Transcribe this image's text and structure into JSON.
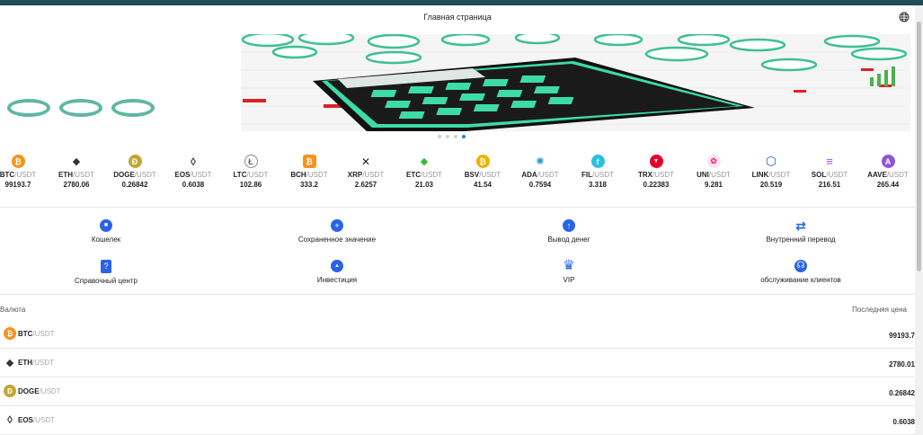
{
  "header": {
    "title": "Главная страница",
    "language_icon": "globe-icon"
  },
  "banner": {
    "slides_count": 4,
    "active_slide": 4
  },
  "ticker": [
    {
      "base": "BTC",
      "quote": "/USDT",
      "price": "99193.7",
      "icon": "bitcoin-icon",
      "color": "#f7931a",
      "glyph": "₿"
    },
    {
      "base": "ETH",
      "quote": "/USDT",
      "price": "2780.06",
      "icon": "ethereum-icon",
      "color": "#3c3c3d",
      "glyph": "◆"
    },
    {
      "base": "DOGE",
      "quote": "/USDT",
      "price": "0.26842",
      "icon": "dogecoin-icon",
      "color": "#c2a633",
      "glyph": "Ð"
    },
    {
      "base": "EOS",
      "quote": "/USDT",
      "price": "0.6038",
      "icon": "eos-icon",
      "color": "#ffffff",
      "glyph": "◊"
    },
    {
      "base": "LTC",
      "quote": "/USDT",
      "price": "102.86",
      "icon": "litecoin-icon",
      "color": "#ffffff",
      "glyph": "Ł"
    },
    {
      "base": "BCH",
      "quote": "/USDT",
      "price": "333.2",
      "icon": "bitcoin-cash-icon",
      "color": "#f7931a",
      "glyph": "₿"
    },
    {
      "base": "XRP",
      "quote": "/USDT",
      "price": "2.6257",
      "icon": "xrp-icon",
      "color": "#ffffff",
      "glyph": "✕"
    },
    {
      "base": "ETC",
      "quote": "/USDT",
      "price": "21.03",
      "icon": "ethereum-classic-icon",
      "color": "#ffffff",
      "glyph": "◆"
    },
    {
      "base": "BSV",
      "quote": "/USDT",
      "price": "41.54",
      "icon": "bitcoin-sv-icon",
      "color": "#eab300",
      "glyph": "₿"
    },
    {
      "base": "ADA",
      "quote": "/USDT",
      "price": "0.7594",
      "icon": "cardano-icon",
      "color": "#ffffff",
      "glyph": "✺"
    },
    {
      "base": "FIL",
      "quote": "/USDT",
      "price": "3.318",
      "icon": "filecoin-icon",
      "color": "#0090ff",
      "glyph": "f"
    },
    {
      "base": "TRX",
      "quote": "/USDT",
      "price": "0.22383",
      "icon": "tron-icon",
      "color": "#eb0029",
      "glyph": "▼"
    },
    {
      "base": "UNI",
      "quote": "/USDT",
      "price": "9.281",
      "icon": "uniswap-icon",
      "color": "#ff007a",
      "glyph": "✿"
    },
    {
      "base": "LINK",
      "quote": "/USDT",
      "price": "20.519",
      "icon": "chainlink-icon",
      "color": "#2a5ada",
      "glyph": "⬡"
    },
    {
      "base": "SOL",
      "quote": "/USDT",
      "price": "216.51",
      "icon": "solana-icon",
      "color": "#9945ff",
      "glyph": "≡"
    },
    {
      "base": "AAVE",
      "quote": "/USDT",
      "price": "265.44",
      "icon": "aave-icon",
      "color": "#8f55d8",
      "glyph": "A"
    }
  ],
  "menu": [
    {
      "label": "Кошелек",
      "icon": "wallet-icon",
      "glyph": "■"
    },
    {
      "label": "Сохраненное значение",
      "icon": "deposit-plus-icon",
      "glyph": "+"
    },
    {
      "label": "Вывод денег",
      "icon": "withdraw-arrow-icon",
      "glyph": "↑"
    },
    {
      "label": "Внутренний перевод",
      "icon": "transfer-arrows-icon",
      "glyph": "⇄"
    },
    {
      "label": "Справочный центр",
      "icon": "help-document-icon",
      "glyph": "?"
    },
    {
      "label": "Инвестиция",
      "icon": "investment-icon",
      "glyph": "▲"
    },
    {
      "label": "VIP",
      "icon": "vip-crown-icon",
      "glyph": "♛"
    },
    {
      "label": "обслуживание клиентов",
      "icon": "customer-service-headset-icon",
      "glyph": "☊"
    }
  ],
  "market": {
    "col_currency": "Валюта",
    "col_last_price": "Последняя цена",
    "rows": [
      {
        "base": "BTC",
        "quote": "/USDT",
        "price": "99193.7",
        "icon": "bitcoin-icon",
        "color": "#f7931a",
        "glyph": "₿"
      },
      {
        "base": "ETH",
        "quote": "/USDT",
        "price": "2780.01",
        "icon": "ethereum-icon",
        "color": "#3c3c3d",
        "glyph": "◆"
      },
      {
        "base": "DOGE",
        "quote": "/USDT",
        "price": "0.26842",
        "icon": "dogecoin-icon",
        "color": "#c2a633",
        "glyph": "Ð"
      },
      {
        "base": "EOS",
        "quote": "/USDT",
        "price": "0.6038",
        "icon": "eos-icon",
        "color": "#ffffff",
        "glyph": "◊"
      }
    ]
  }
}
